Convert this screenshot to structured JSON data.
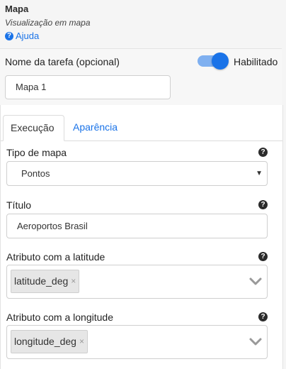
{
  "header": {
    "title": "Mapa",
    "subtitle": "Visualização em mapa",
    "help_label": "Ajuda"
  },
  "task": {
    "name_label": "Nome da tarefa (opcional)",
    "enabled_label": "Habilitado",
    "enabled": true,
    "name_value": "Mapa 1"
  },
  "tabs": [
    {
      "label": "Execução",
      "active": true
    },
    {
      "label": "Aparência",
      "active": false
    }
  ],
  "fields": {
    "map_type": {
      "label": "Tipo de mapa",
      "value": "Pontos"
    },
    "title": {
      "label": "Título",
      "value": "Aeroportos Brasil"
    },
    "latitude": {
      "label": "Atributo com a latitude",
      "chip": "latitude_deg"
    },
    "longitude": {
      "label": "Atributo com a longitude",
      "chip": "longitude_deg"
    }
  },
  "colors": {
    "accent": "#1a73e8",
    "toggle_track": "#7fb0f0"
  }
}
